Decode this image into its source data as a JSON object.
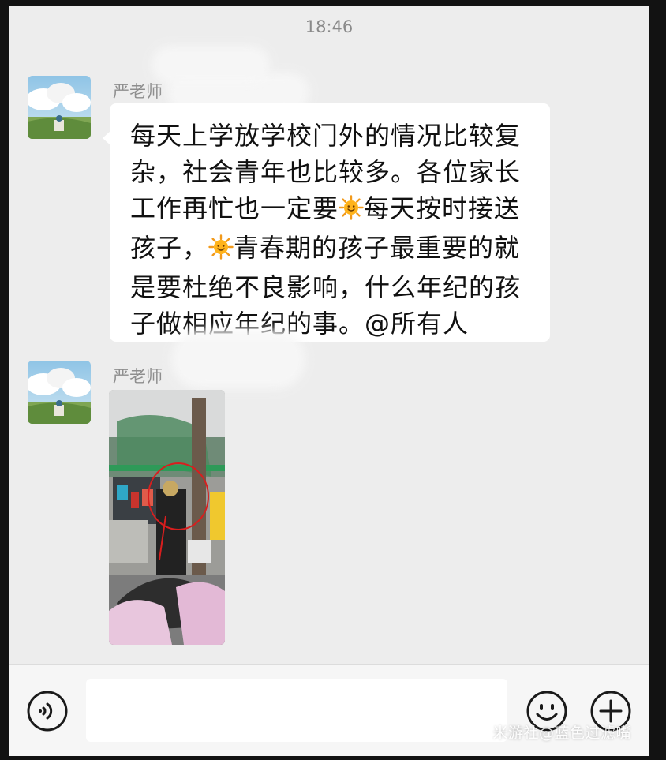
{
  "status": {
    "time": "18:46"
  },
  "messages": [
    {
      "sender": "严老师",
      "text_lines": [
        [
          "每天上学放学校门外的情况比较复"
        ],
        [
          "杂，社会青年也比较多。各位家长"
        ],
        [
          "工作再忙也一定要",
          "☀",
          "每天按时接送"
        ],
        [
          "孩子，",
          "☀",
          "青春期的孩子最重要的就"
        ],
        [
          "是要杜绝不良影响，什么年纪的孩"
        ],
        [
          "子做相应年纪的事。@所有人"
        ]
      ]
    },
    {
      "sender": "严老师",
      "image": "school-gate-photo"
    }
  ],
  "input_bar": {
    "voice_icon": "voice-icon",
    "emoji_icon": "emoji-icon",
    "plus_icon": "plus-icon",
    "input_value": ""
  },
  "watermark": "米游社@蓝色过滤嘴"
}
